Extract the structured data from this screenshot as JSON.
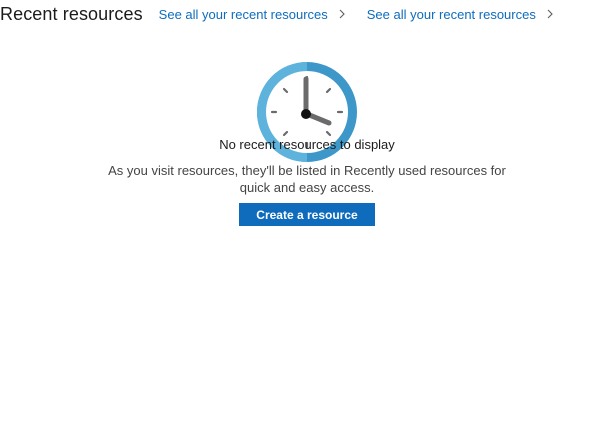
{
  "header": {
    "title": "Recent resources",
    "links": [
      {
        "label": "See all your recent resources"
      },
      {
        "label": "See all your recent resources"
      }
    ]
  },
  "empty_state": {
    "icon": "clock-icon",
    "heading": "No recent resources to display",
    "description": "As you visit resources, they'll be listed in Recently used resources for quick and easy access.",
    "button_label": "Create a resource"
  },
  "colors": {
    "link": "#0f6cbd",
    "button_bg": "#0f6cbd",
    "clock_ring": "#3a96c8",
    "clock_face": "#ffffff"
  }
}
